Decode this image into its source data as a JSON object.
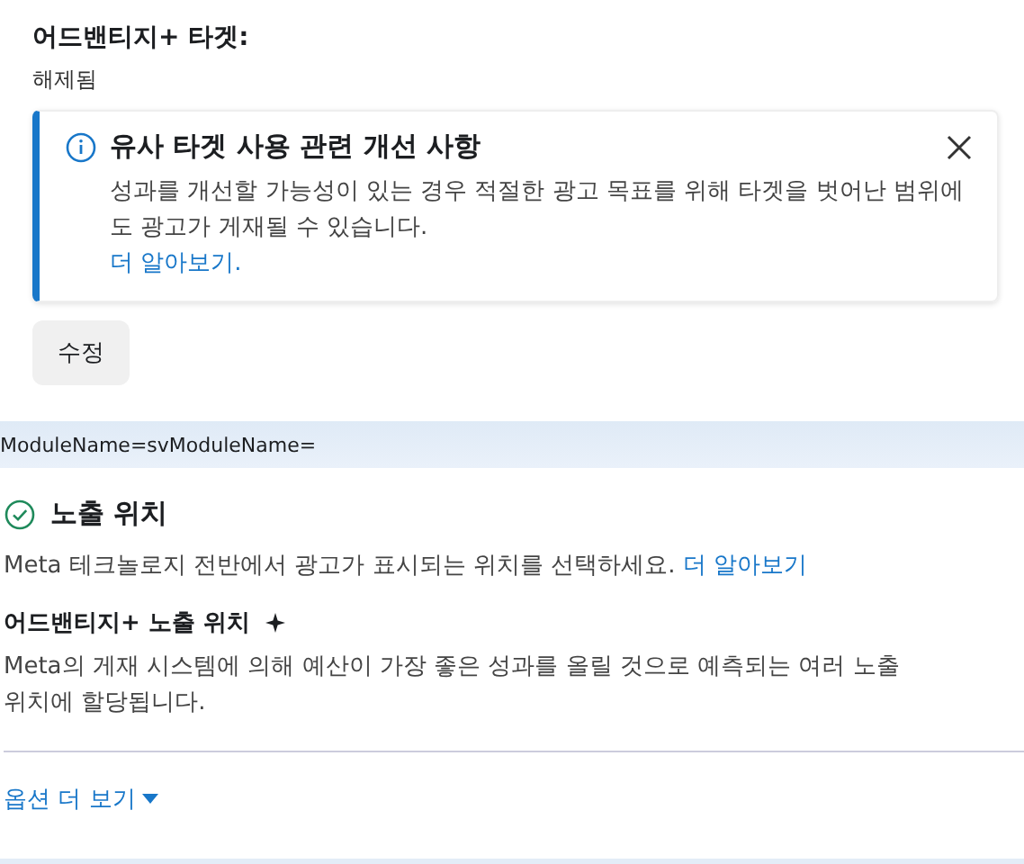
{
  "targeting": {
    "label": "어드밴티지+ 타겟:",
    "value": "해제됨"
  },
  "notice": {
    "title": "유사 타겟 사용 관련 개선 사항",
    "body": "성과를 개선할 가능성이 있는 경우 적절한 광고 목표를 위해 타겟을 벗어난 범위에도 광고가 게재될 수 있습니다.",
    "link": "더 알아보기."
  },
  "edit_button": "수정",
  "debug_banner": "ModuleName=svModuleName=",
  "placements": {
    "title": "노출 위치",
    "description": "Meta 테크놀로지 전반에서 광고가 표시되는 위치를 선택하세요.",
    "link": "더 알아보기",
    "subtitle": "어드밴티지+ 노출 위치",
    "subdescription": "Meta의 게재 시스템에 의해 예산이 가장 좋은 성과를 올릴 것으로 예측되는 여러 노출 위치에 할당됩니다.",
    "more_options": "옵션 더 보기"
  }
}
